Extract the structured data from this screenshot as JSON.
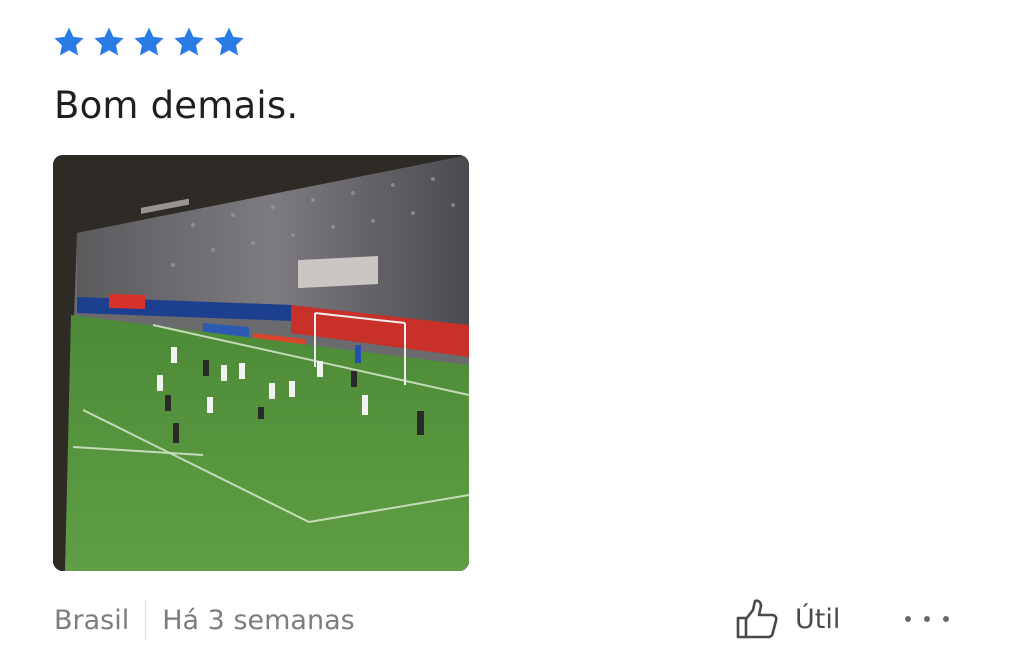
{
  "review": {
    "rating": 5,
    "rating_max": 5,
    "text": "Bom demais.",
    "location": "Brasil",
    "time_ago": "Há 3 semanas",
    "helpful_label": "Útil",
    "star_color": "#2b7be6"
  },
  "icons": {
    "star": "star-icon",
    "helpful": "thumbs-up-icon",
    "more": "more-options-icon"
  }
}
